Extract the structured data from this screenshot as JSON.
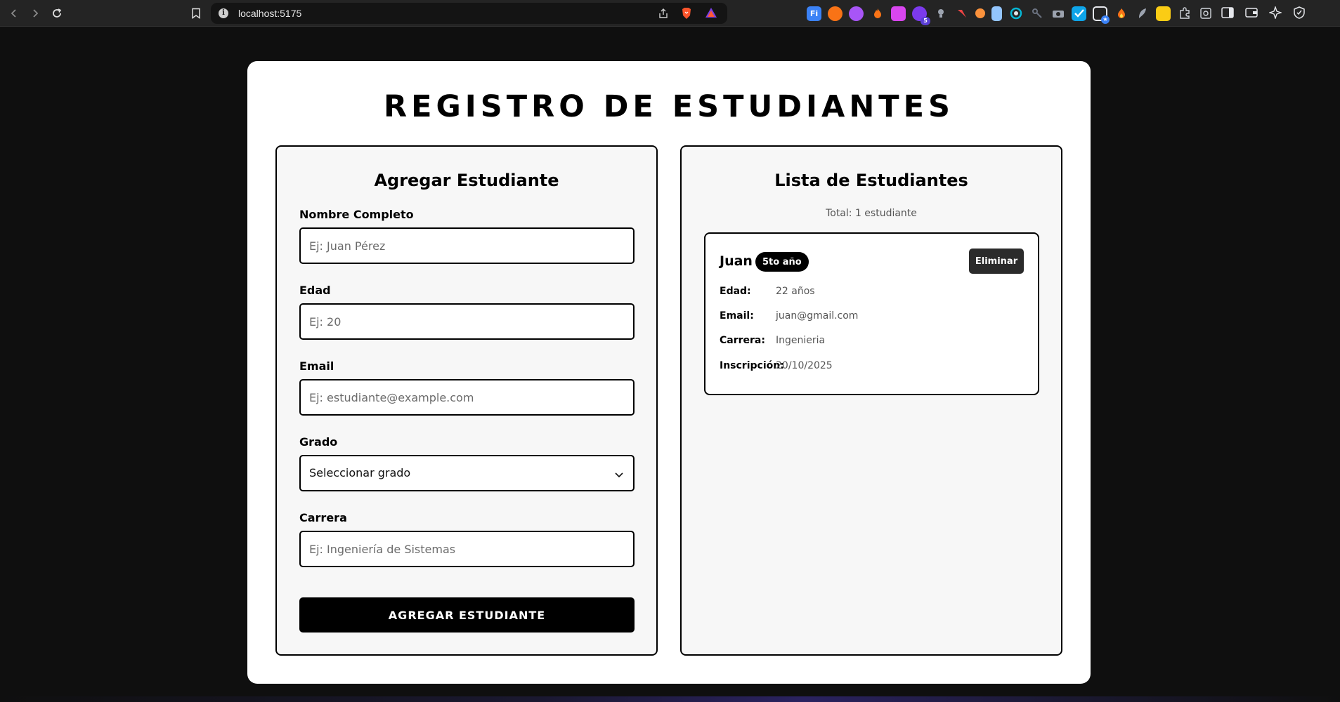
{
  "browser": {
    "url": "localhost:5175",
    "extension_badge": "5",
    "extensions": [
      {
        "icon": "f-letter-icon",
        "label": "Fi",
        "color": "#3b82f6"
      },
      {
        "icon": "orange-circle-icon",
        "label": "",
        "color": "#f97316"
      },
      {
        "icon": "purple-hex-icon",
        "label": "",
        "color": "#a855f7"
      },
      {
        "icon": "flame-icon",
        "label": "",
        "color": "#f97316"
      },
      {
        "icon": "pink-square-icon",
        "label": "",
        "color": "#d946ef"
      },
      {
        "icon": "purple-puzzle-icon",
        "label": "",
        "color": "#7c3aed"
      },
      {
        "icon": "bulb-icon",
        "label": "",
        "color": "#9ca3af"
      },
      {
        "icon": "red-tool-icon",
        "label": "",
        "color": "#ef4444"
      },
      {
        "icon": "orange-dot-icon",
        "label": "",
        "color": "#fb923c"
      },
      {
        "icon": "file-icon",
        "label": "",
        "color": "#93c5fd"
      },
      {
        "icon": "refresh-circle-icon",
        "label": "",
        "color": "#06b6d4"
      },
      {
        "icon": "key-icon",
        "label": "",
        "color": "#6b7280"
      },
      {
        "icon": "camera-icon",
        "label": "",
        "color": "#9ca3af"
      },
      {
        "icon": "check-icon",
        "label": "",
        "color": "#0ea5e9"
      },
      {
        "icon": "window-icon",
        "label": "",
        "color": "#60a5fa"
      },
      {
        "icon": "fire-icon",
        "label": "",
        "color": "#f97316"
      },
      {
        "icon": "feather-icon",
        "label": "",
        "color": "#9ca3af"
      },
      {
        "icon": "yellow-lock-icon",
        "label": "",
        "color": "#facc15"
      },
      {
        "icon": "puzzle-icon",
        "label": "",
        "color": "#d1d5db"
      },
      {
        "icon": "search-page-icon",
        "label": "",
        "color": "#d1d5db"
      }
    ]
  },
  "page": {
    "title": "REGISTRO DE ESTUDIANTES"
  },
  "form": {
    "title": "Agregar Estudiante",
    "fields": {
      "name": {
        "label": "Nombre Completo",
        "placeholder": "Ej: Juan Pérez",
        "value": ""
      },
      "age": {
        "label": "Edad",
        "placeholder": "Ej: 20",
        "value": ""
      },
      "email": {
        "label": "Email",
        "placeholder": "Ej: estudiante@example.com",
        "value": ""
      },
      "grade": {
        "label": "Grado",
        "selected": "Seleccionar grado"
      },
      "career": {
        "label": "Carrera",
        "placeholder": "Ej: Ingeniería de Sistemas",
        "value": ""
      }
    },
    "submit_label": "AGREGAR ESTUDIANTE"
  },
  "list": {
    "title": "Lista de Estudiantes",
    "total": "Total: 1 estudiante",
    "students": [
      {
        "name": "Juan",
        "grade": "5to año",
        "delete_label": "Eliminar",
        "age_label": "Edad:",
        "age": "22 años",
        "email_label": "Email:",
        "email": "juan@gmail.com",
        "career_label": "Carrera:",
        "career": "Ingenieria",
        "enrolled_label": "Inscripción:",
        "enrolled": "20/10/2025"
      }
    ]
  }
}
